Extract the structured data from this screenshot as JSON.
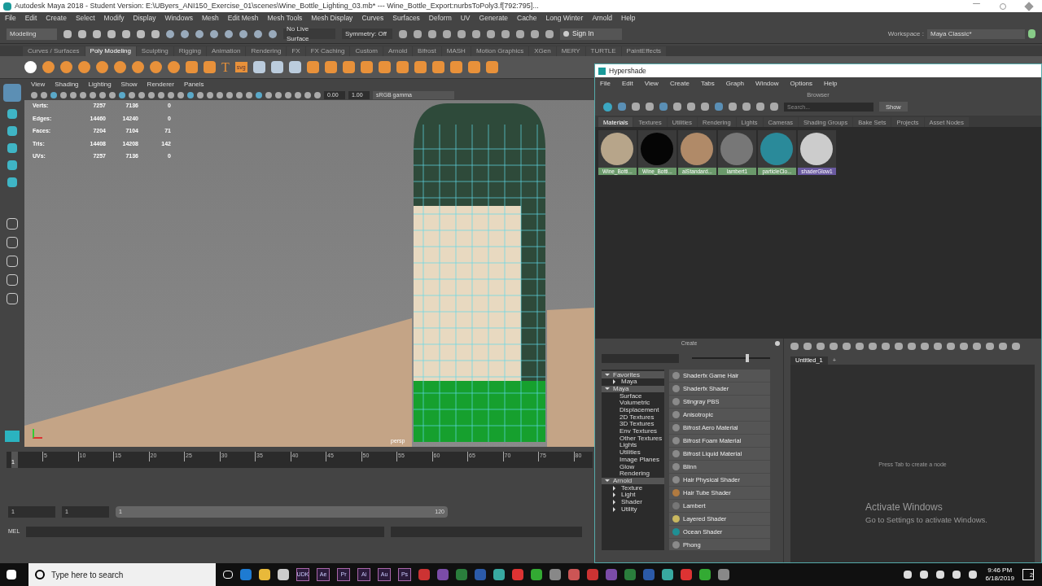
{
  "window": {
    "title": "Autodesk Maya 2018 - Student Version: E:\\UByers_ANI150_Exercise_01\\scenes\\Wine_Bottle_Lighting_03.mb*   ---   Wine_Bottle_Export:nurbsToPoly3.f[792:795]..."
  },
  "menu": [
    "File",
    "Edit",
    "Create",
    "Select",
    "Modify",
    "Display",
    "Windows",
    "Mesh",
    "Edit Mesh",
    "Mesh Tools",
    "Mesh Display",
    "Curves",
    "Surfaces",
    "Deform",
    "UV",
    "Generate",
    "Cache",
    "Long Winter",
    "Arnold",
    "Help"
  ],
  "status_line": {
    "mode": "Modeling",
    "live_surface": "No Live Surface",
    "symmetry": "Symmetry: Off",
    "sign_in": "Sign In",
    "workspace_label": "Workspace :",
    "workspace": "Maya Classic*"
  },
  "shelf_tabs": [
    {
      "label": "Curves / Surfaces",
      "selected": false
    },
    {
      "label": "Poly Modeling",
      "selected": true
    },
    {
      "label": "Sculpting",
      "selected": false
    },
    {
      "label": "Rigging",
      "selected": false
    },
    {
      "label": "Animation",
      "selected": false
    },
    {
      "label": "Rendering",
      "selected": false
    },
    {
      "label": "FX",
      "selected": false
    },
    {
      "label": "FX Caching",
      "selected": false
    },
    {
      "label": "Custom",
      "selected": false
    },
    {
      "label": "Arnold",
      "selected": false
    },
    {
      "label": "Bifrost",
      "selected": false
    },
    {
      "label": "MASH",
      "selected": false
    },
    {
      "label": "Motion Graphics",
      "selected": false
    },
    {
      "label": "XGen",
      "selected": false
    },
    {
      "label": "MERY",
      "selected": false
    },
    {
      "label": "TURTLE",
      "selected": false
    },
    {
      "label": "PaintEffects",
      "selected": false
    }
  ],
  "shelf_texts": [
    "T",
    "svg"
  ],
  "viewport": {
    "menu": [
      "View",
      "Shading",
      "Lighting",
      "Show",
      "Renderer",
      "Panels"
    ],
    "exposure": "0.00",
    "gamma": "1.00",
    "color_space": "sRGB gamma",
    "camera": "persp",
    "stats": [
      {
        "label": "Verts:",
        "values": [
          "7257",
          "7136",
          "0"
        ]
      },
      {
        "label": "Edges:",
        "values": [
          "14460",
          "14240",
          "0"
        ]
      },
      {
        "label": "Faces:",
        "values": [
          "7204",
          "7104",
          "71"
        ]
      },
      {
        "label": "Tris:",
        "values": [
          "14408",
          "14208",
          "142"
        ]
      },
      {
        "label": "UVs:",
        "values": [
          "7257",
          "7136",
          "0"
        ]
      }
    ]
  },
  "timeline": {
    "current": "1",
    "level": 0,
    "ticks": [
      "5",
      "10",
      "15",
      "20",
      "25",
      "30",
      "35",
      "40",
      "45",
      "50",
      "55",
      "60",
      "65",
      "70",
      "75",
      "80"
    ]
  },
  "range": {
    "start": "1",
    "playback_start": "1",
    "slider_start": "1",
    "slider_end": "120",
    "level": 1
  },
  "command_line": {
    "label": "MEL"
  },
  "hypershade": {
    "title": "Hypershade",
    "menu": [
      "File",
      "Edit",
      "View",
      "Create",
      "Tabs",
      "Graph",
      "Window",
      "Options",
      "Help"
    ],
    "browser_label": "Browser",
    "search_placeholder": "Search...",
    "show_button": "Show",
    "tabs": [
      {
        "label": "Materials",
        "selected": true
      },
      {
        "label": "Textures",
        "selected": false
      },
      {
        "label": "Utilities",
        "selected": false
      },
      {
        "label": "Rendering",
        "selected": false
      },
      {
        "label": "Lights",
        "selected": false
      },
      {
        "label": "Cameras",
        "selected": false
      },
      {
        "label": "Shading Groups",
        "selected": false
      },
      {
        "label": "Bake Sets",
        "selected": false
      },
      {
        "label": "Projects",
        "selected": false
      },
      {
        "label": "Asset Nodes",
        "selected": false
      }
    ],
    "materials": [
      {
        "name": "Wine_Botti...",
        "color": "#b7a58a",
        "selected": false
      },
      {
        "name": "Wine_Botti...",
        "color": "#050505",
        "selected": false
      },
      {
        "name": "aiStandard...",
        "color": "#b08a68",
        "selected": false
      },
      {
        "name": "lambert1",
        "color": "#777777",
        "selected": false
      },
      {
        "name": "particleClo...",
        "color": "#2a8a9a",
        "selected": false
      },
      {
        "name": "shaderGlow1",
        "color": "#cccccc",
        "selected": true
      }
    ],
    "create_title": "Create",
    "swatch_size": {
      "level": 0.72
    },
    "tree": [
      {
        "label": "Favorites",
        "expanded": true,
        "children": [
          {
            "label": "Maya",
            "expanded": false
          }
        ]
      },
      {
        "label": "Maya",
        "expanded": true,
        "children": [
          {
            "label": "Surface"
          },
          {
            "label": "Volumetric"
          },
          {
            "label": "Displacement"
          },
          {
            "label": "2D Textures"
          },
          {
            "label": "3D Textures"
          },
          {
            "label": "Env Textures"
          },
          {
            "label": "Other Textures"
          },
          {
            "label": "Lights"
          },
          {
            "label": "Utilities"
          },
          {
            "label": "Image Planes"
          },
          {
            "label": "Glow"
          },
          {
            "label": "Rendering"
          }
        ]
      },
      {
        "label": "Arnold",
        "expanded": true,
        "children": [
          {
            "label": "Texture",
            "expanded": false
          },
          {
            "label": "Light",
            "expanded": false
          },
          {
            "label": "Shader",
            "expanded": false
          },
          {
            "label": "Utility",
            "expanded": false
          }
        ]
      }
    ],
    "nodes": [
      {
        "label": "Shaderfx Game Hair",
        "color": "#8a8a8a"
      },
      {
        "label": "Shaderfx Shader",
        "color": "#8a8a8a"
      },
      {
        "label": "Stingray PBS",
        "color": "#8a8a8a"
      },
      {
        "label": "Anisotropic",
        "color": "#8a8a8a"
      },
      {
        "label": "Bifrost Aero Material",
        "color": "#8a8a8a"
      },
      {
        "label": "Bifrost Foam Material",
        "color": "#8a8a8a"
      },
      {
        "label": "Bifrost Liquid Material",
        "color": "#8a8a8a"
      },
      {
        "label": "Blinn",
        "color": "#8a8a8a"
      },
      {
        "label": "Hair Physical Shader",
        "color": "#8a8a8a"
      },
      {
        "label": "Hair Tube Shader",
        "color": "#b07a40"
      },
      {
        "label": "Lambert",
        "color": "#777777"
      },
      {
        "label": "Layered Shader",
        "color": "#c9b860"
      },
      {
        "label": "Ocean Shader",
        "color": "#1f8f94"
      },
      {
        "label": "Phong",
        "color": "#8a8a8a"
      }
    ],
    "graph_tab": "Untitled_1",
    "add_tab": "+",
    "graph_hint": "Press Tab to create a node"
  },
  "activation": {
    "title": "Activate Windows",
    "message": "Go to Settings to activate Windows."
  },
  "taskbar": {
    "search_placeholder": "Type here to search",
    "apps": [
      "UDK",
      "Ae",
      "Pr",
      "Ai",
      "Au",
      "Ps"
    ],
    "time": "9:46 PM",
    "date": "6/18/2019",
    "notifications": "2"
  }
}
